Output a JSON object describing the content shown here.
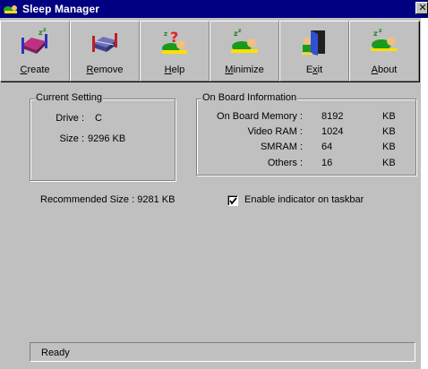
{
  "window": {
    "title": "Sleep Manager",
    "close_glyph": "✕",
    "app_icon": "sleeping-figure-icon"
  },
  "toolbar": {
    "buttons": [
      {
        "label": "Create",
        "accel": "C",
        "rest": "reate",
        "icon": "create-bed-icon"
      },
      {
        "label": "Remove",
        "accel": "R",
        "rest": "emove",
        "icon": "remove-bed-icon"
      },
      {
        "label": "Help",
        "accel": "H",
        "rest": "elp",
        "icon": "help-question-icon"
      },
      {
        "label": "Minimize",
        "accel": "M",
        "rest": "inimize",
        "icon": "minimize-sleeper-icon"
      },
      {
        "label": "Exit",
        "pre": "E",
        "accel": "x",
        "rest": "it",
        "icon": "exit-door-icon"
      },
      {
        "label": "About",
        "accel": "A",
        "rest": "bout",
        "icon": "about-sleeper-icon"
      }
    ]
  },
  "current_setting": {
    "title": "Current Setting",
    "drive_label": "Drive :",
    "drive_value": "C",
    "size_label": "Size :",
    "size_value": "9296 KB"
  },
  "onboard_info": {
    "title": "On Board Information",
    "rows": [
      {
        "label": "On Board Memory :",
        "value": "8192",
        "unit": "KB"
      },
      {
        "label": "Video RAM :",
        "value": "1024",
        "unit": "KB"
      },
      {
        "label": "SMRAM :",
        "value": "64",
        "unit": "KB"
      },
      {
        "label": "Others :",
        "value": "16",
        "unit": "KB"
      }
    ]
  },
  "recommended": {
    "text": "Recommended Size : 9281 KB"
  },
  "indicator": {
    "label": "Enable indicator on taskbar",
    "checked": true
  },
  "status": {
    "text": "Ready"
  },
  "colors": {
    "titlebar": "#000080",
    "face": "#c0c0c0"
  }
}
